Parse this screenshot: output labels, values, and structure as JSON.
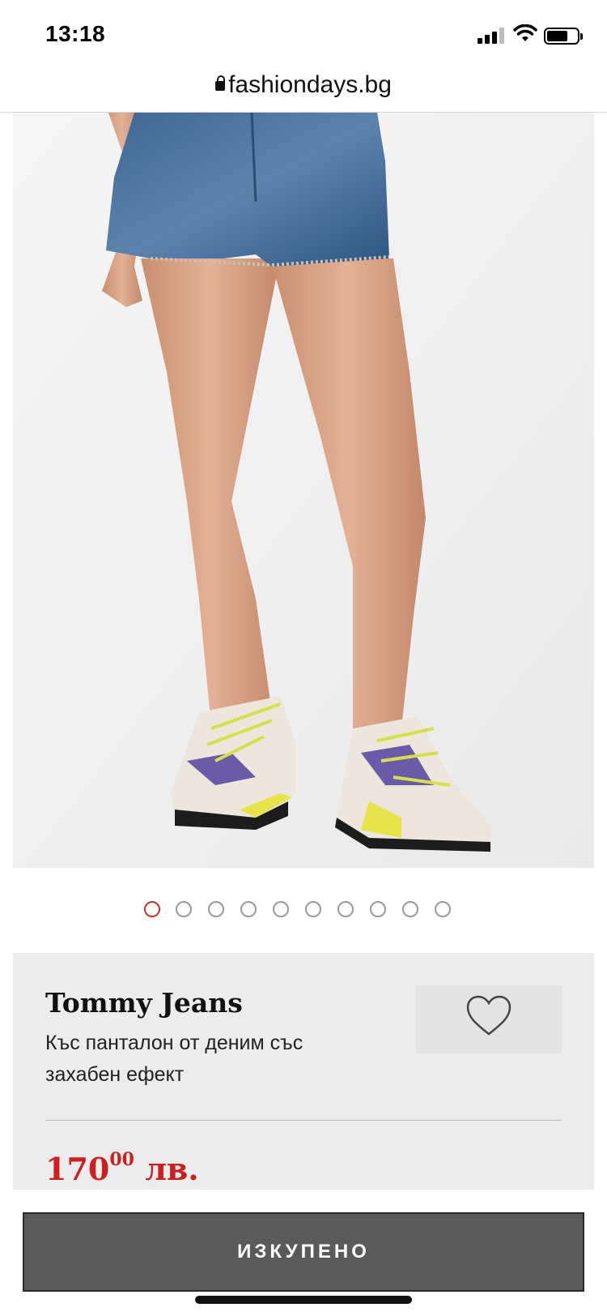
{
  "status_bar": {
    "time": "13:18"
  },
  "browser": {
    "url": "fashiondays.bg"
  },
  "gallery": {
    "total_images": 10,
    "active_index": 0
  },
  "product": {
    "brand": "Tommy Jeans",
    "name": "Къс панталон от деним със захабен ефект",
    "price_main": "170",
    "price_cents": "00",
    "currency": "лв."
  },
  "actions": {
    "sold_out_label": "ИЗКУПЕНО"
  },
  "colors": {
    "accent_red": "#cc1f1f",
    "button_gray": "#5a5a5a",
    "panel_bg": "#ececec"
  }
}
